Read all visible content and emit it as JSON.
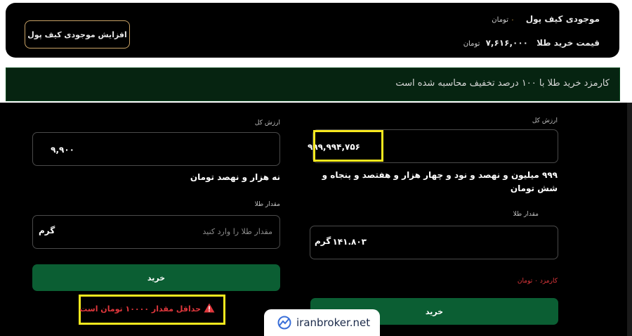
{
  "wallet": {
    "balance_label": "موجودی کیف پول",
    "balance_value": "۰",
    "balance_unit": "تومان",
    "gold_price_label": "قیمت خرید طلا",
    "gold_price_value": "۷,۶۱۶,۰۰۰",
    "gold_price_unit": "تومان",
    "increase_button": "افزایش موجودی کیف پول"
  },
  "notice": {
    "text": "کارمزد خرید طلا با ۱۰۰ درصد تخفیف محاسبه شده است"
  },
  "right_form": {
    "total_value_label": "ارزش کل",
    "total_value": "۹۹۹,۹۹۴,۷۵۶",
    "total_value_words": "۹۹۹ میلیون و نهصد و نود و چهار هزار و هفتصد و پنجاه و شش تومان",
    "gold_amount_label": "مقدار طلا",
    "gold_amount_value": "۱۴۱.۸۰۳",
    "gold_amount_unit": "گرم",
    "fee_label": "کارمزد",
    "fee_value": "۰",
    "fee_unit": "تومان",
    "buy_button": "خرید"
  },
  "left_form": {
    "total_value_label": "ارزش کل",
    "total_value": "۹,۹۰۰",
    "total_value_words": "نه هزار و نهصد تومان",
    "gold_amount_label": "مقدار طلا",
    "gold_amount_placeholder": "مقدار طلا را وارد کنید",
    "gold_amount_unit": "گرم",
    "buy_button": "خرید",
    "error_text": "حداقل مقدار ۱۰۰۰۰ تومان است"
  },
  "watermark": {
    "text": "iranbroker.net"
  },
  "colors": {
    "accent_green": "#0b5e33",
    "highlight_yellow": "#f7e81e",
    "error_red": "#e0373c",
    "gold_border": "#c8a266"
  }
}
